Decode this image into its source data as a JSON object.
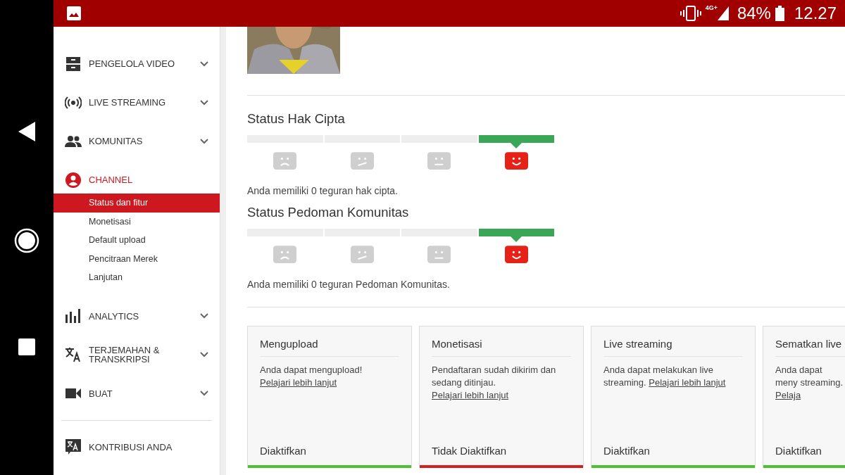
{
  "status_bar": {
    "network": "4G+",
    "battery": "84%",
    "time": "12.27"
  },
  "sidebar": {
    "items": [
      {
        "label": "PENGELOLA VIDEO",
        "expandable": true,
        "selected": false
      },
      {
        "label": "LIVE STREAMING",
        "expandable": true,
        "selected": false
      },
      {
        "label": "KOMUNITAS",
        "expandable": true,
        "selected": false
      },
      {
        "label": "CHANNEL",
        "expandable": false,
        "selected": true,
        "children": [
          {
            "label": "Status dan fitur",
            "selected": true
          },
          {
            "label": "Monetisasi",
            "selected": false
          },
          {
            "label": "Default upload",
            "selected": false
          },
          {
            "label": "Pencitraan Merek",
            "selected": false
          },
          {
            "label": "Lanjutan",
            "selected": false
          }
        ]
      },
      {
        "label": "ANALYTICS",
        "expandable": true,
        "selected": false
      },
      {
        "label": "TERJEMAHAN & TRANSKRIPSI",
        "expandable": true,
        "selected": false
      },
      {
        "label": "BUAT",
        "expandable": true,
        "selected": false
      }
    ],
    "footer_items": [
      {
        "label": "KONTRIBUSI ANDA",
        "selected": false
      }
    ]
  },
  "main": {
    "sections": [
      {
        "title": "Status Hak Cipta",
        "segments": [
          {
            "kind": "sad",
            "selected": false
          },
          {
            "kind": "skeptical",
            "selected": false
          },
          {
            "kind": "neutral",
            "selected": false
          },
          {
            "kind": "happy",
            "selected": true
          }
        ],
        "summary": "Anda memiliki 0 teguran hak cipta."
      },
      {
        "title": "Status Pedoman Komunitas",
        "segments": [
          {
            "kind": "sad",
            "selected": false
          },
          {
            "kind": "skeptical",
            "selected": false
          },
          {
            "kind": "neutral",
            "selected": false
          },
          {
            "kind": "happy",
            "selected": true
          }
        ],
        "summary": "Anda memiliki 0 teguran Pedoman Komunitas."
      }
    ],
    "features": [
      {
        "title": "Mengupload",
        "text": "Anda dapat mengupload!",
        "link": "Pelajari lebih lanjut",
        "status": "Diaktifkan",
        "enabled": true
      },
      {
        "title": "Monetisasi",
        "text": "Pendaftaran sudah dikirim dan sedang ditinjau.",
        "link": "Pelajari lebih lanjut",
        "status": "Tidak Diaktifkan",
        "enabled": false
      },
      {
        "title": "Live streaming",
        "text": "Anda dapat melakukan live streaming.",
        "link": "Pelajari lebih lanjut",
        "status": "Diaktifkan",
        "enabled": true
      },
      {
        "title": "Sematkan live",
        "text": "Anda dapat meny streaming.",
        "link": "Pelaja",
        "status": "Diaktifkan",
        "enabled": true
      }
    ]
  }
}
